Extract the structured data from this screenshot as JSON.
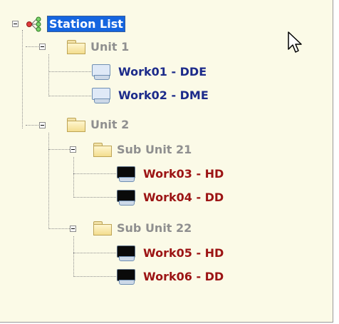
{
  "tree": {
    "root": {
      "label": "Station List",
      "icon": "network-icon",
      "selected": true
    },
    "units": [
      {
        "label": "Unit 1",
        "children": [
          {
            "label": "Work01 - DDE",
            "icon": "monitor-light-icon"
          },
          {
            "label": "Work02 - DME",
            "icon": "monitor-light-icon"
          }
        ]
      },
      {
        "label": "Unit 2",
        "subunits": [
          {
            "label": "Sub Unit 21",
            "children": [
              {
                "label": "Work03 - HD",
                "icon": "monitor-dark-icon"
              },
              {
                "label": "Work04 - DD",
                "icon": "monitor-dark-icon"
              }
            ]
          },
          {
            "label": "Sub Unit 22",
            "children": [
              {
                "label": "Work05 - HD",
                "icon": "monitor-dark-icon"
              },
              {
                "label": "Work06 - DD",
                "icon": "monitor-dark-icon"
              }
            ]
          }
        ]
      }
    ]
  },
  "colors": {
    "background": "#fbfae7",
    "folder_label": "#8f8f8f",
    "work_blue": "#1c2b8a",
    "work_red": "#9c1414",
    "selection": "#1565e0"
  }
}
